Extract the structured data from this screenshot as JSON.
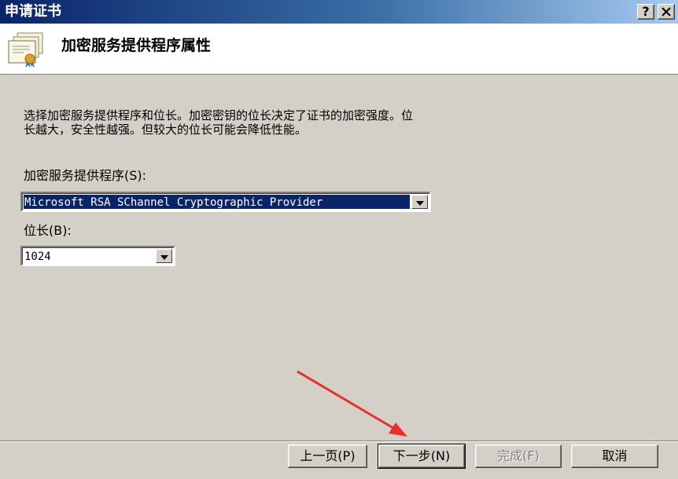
{
  "window": {
    "title": "申请证书",
    "help_button": "?",
    "close_button": "X"
  },
  "header": {
    "title": "加密服务提供程序属性"
  },
  "body": {
    "description": "选择加密服务提供程序和位长。加密密钥的位长决定了证书的加密强度。位长越大，安全性越强。但较大的位长可能会降低性能。",
    "csp_label": "加密服务提供程序(S):",
    "csp_value": "Microsoft RSA SChannel Cryptographic Provider",
    "bitlength_label": "位长(B):",
    "bitlength_value": "1024"
  },
  "footer": {
    "back_label": "上一页(P)",
    "next_label": "下一步(N)",
    "finish_label": "完成(F)",
    "cancel_label": "取消"
  },
  "colors": {
    "titlebar_start": "#0a246a",
    "titlebar_end": "#a6caf0",
    "dialog_bg": "#d4d0c8",
    "selection": "#0a246a",
    "annotation_arrow": "#e8312a"
  }
}
